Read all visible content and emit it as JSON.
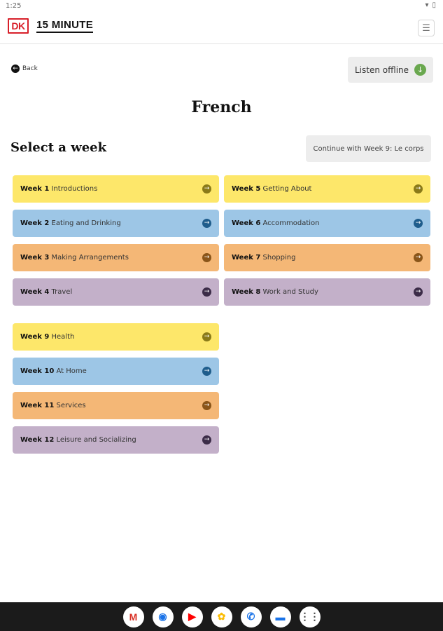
{
  "status": {
    "time": "1:25"
  },
  "header": {
    "logo_dk": "DK",
    "logo_text": "15 MINUTE",
    "menu_icon": "hamburger-menu-icon"
  },
  "nav": {
    "back_label": "Back",
    "listen_offline_label": "Listen offline"
  },
  "page": {
    "title": "French",
    "section_title": "Select a week",
    "continue_label": "Continue with Week 9: Le corps"
  },
  "weeks": [
    {
      "num": "Week 1",
      "name": "Introductions",
      "color": "#fde76a"
    },
    {
      "num": "Week 2",
      "name": "Eating and Drinking",
      "color": "#9dc6e6"
    },
    {
      "num": "Week 3",
      "name": "Making Arrangements",
      "color": "#f4b776"
    },
    {
      "num": "Week 4",
      "name": "Travel",
      "color": "#c3b0c9"
    },
    {
      "num": "Week 5",
      "name": "Getting About",
      "color": "#fde76a"
    },
    {
      "num": "Week 6",
      "name": "Accommodation",
      "color": "#9dc6e6"
    },
    {
      "num": "Week 7",
      "name": "Shopping",
      "color": "#f4b776"
    },
    {
      "num": "Week 8",
      "name": "Work and Study",
      "color": "#c3b0c9"
    },
    {
      "num": "Week 9",
      "name": "Health",
      "color": "#fde76a"
    },
    {
      "num": "Week 10",
      "name": "At Home",
      "color": "#9dc6e6"
    },
    {
      "num": "Week 11",
      "name": "Services",
      "color": "#f4b776"
    },
    {
      "num": "Week 12",
      "name": "Leisure and Socializing",
      "color": "#c3b0c9"
    }
  ],
  "dock": {
    "apps": [
      {
        "icon": "gmail-icon",
        "glyph": "M",
        "color": "#d93025"
      },
      {
        "icon": "chrome-icon",
        "glyph": "◉",
        "color": "#1a73e8"
      },
      {
        "icon": "youtube-icon",
        "glyph": "▶",
        "color": "#ff0000"
      },
      {
        "icon": "photos-icon",
        "glyph": "✿",
        "color": "#fbbc04"
      },
      {
        "icon": "phone-icon",
        "glyph": "✆",
        "color": "#1a73e8"
      },
      {
        "icon": "messages-icon",
        "glyph": "▬",
        "color": "#1a73e8"
      },
      {
        "icon": "app-drawer-icon",
        "glyph": "⋮⋮",
        "color": "#333333"
      }
    ]
  }
}
